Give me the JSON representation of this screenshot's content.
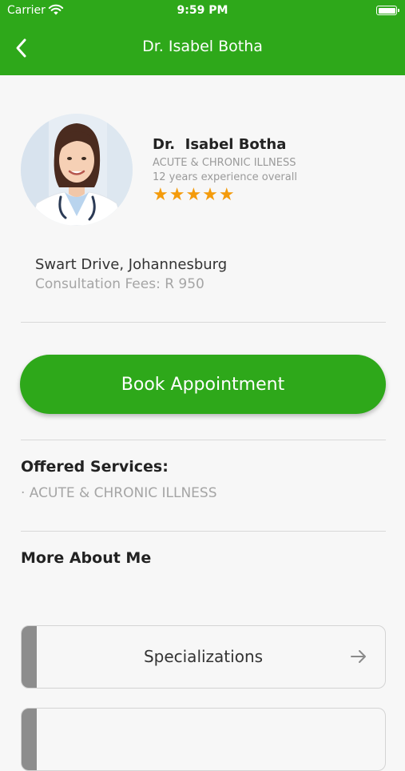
{
  "status_bar": {
    "carrier": "Carrier",
    "time": "9:59 PM"
  },
  "header": {
    "title": "Dr.  Isabel Botha"
  },
  "profile": {
    "name": "Dr.  Isabel Botha",
    "specialty": "ACUTE & CHRONIC ILLNESS",
    "experience": "12 years experience overall",
    "rating": 5,
    "rating_stars": "★★★★★",
    "address": "Swart Drive, Johannesburg",
    "fees": "Consultation Fees: R 950"
  },
  "actions": {
    "book_label": "Book Appointment"
  },
  "services": {
    "title": "Offered Services:",
    "items": [
      "· ACUTE & CHRONIC ILLNESS"
    ]
  },
  "about": {
    "title": "More About Me"
  },
  "cards": [
    {
      "label": "Specializations",
      "icon": "arrow-right-icon"
    },
    {
      "label": "",
      "icon": ""
    }
  ],
  "colors": {
    "brand_green": "#2ea81a",
    "star": "#f49b0b",
    "stripe": "#8d8d8d"
  }
}
